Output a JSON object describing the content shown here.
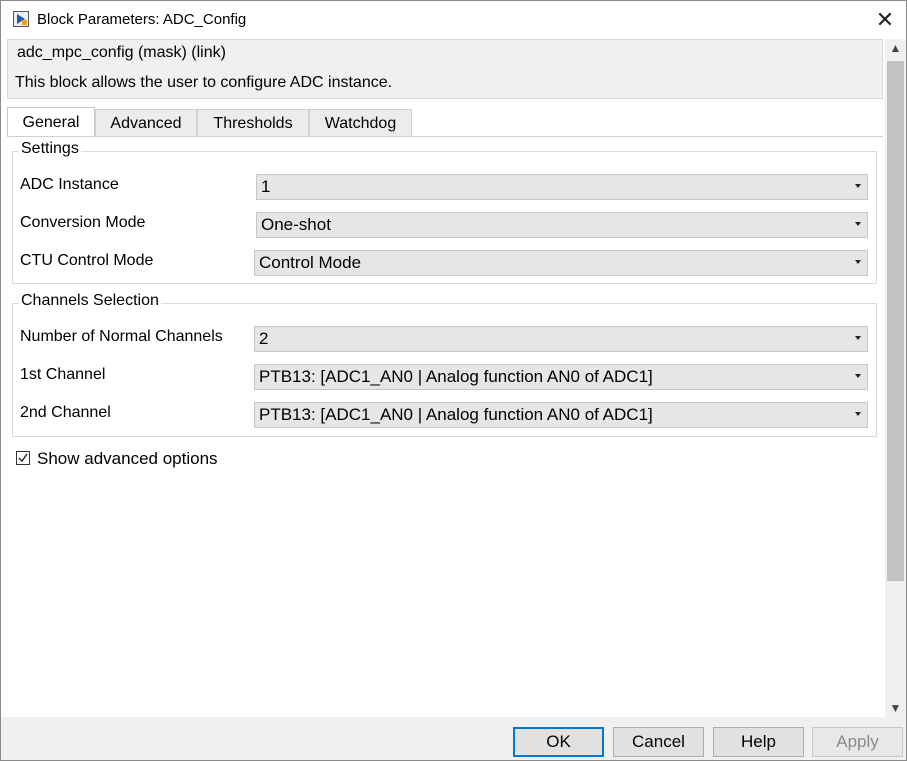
{
  "window": {
    "title": "Block Parameters: ADC_Config",
    "close_glyph": "✕",
    "icon": "simulink-block-icon"
  },
  "mask": {
    "title": "adc_mpc_config (mask) (link)",
    "description": "This block allows the user to configure ADC instance."
  },
  "tabs": [
    {
      "label": "General",
      "active": true
    },
    {
      "label": "Advanced",
      "active": false
    },
    {
      "label": "Thresholds",
      "active": false
    },
    {
      "label": "Watchdog",
      "active": false
    }
  ],
  "settings": {
    "group_title": "Settings",
    "rows": [
      {
        "label": "ADC Instance",
        "value": "1"
      },
      {
        "label": "Conversion Mode",
        "value": "One-shot"
      },
      {
        "label": "CTU Control Mode",
        "value": "Control Mode"
      }
    ]
  },
  "channels": {
    "group_title": "Channels Selection",
    "rows": [
      {
        "label": "Number of Normal Channels",
        "value": "2"
      },
      {
        "label": "1st Channel",
        "value": "PTB13: [ADC1_AN0 | Analog function AN0 of ADC1]"
      },
      {
        "label": "2nd Channel",
        "value": "PTB13: [ADC1_AN0 | Analog function AN0 of ADC1]"
      }
    ]
  },
  "advanced_option": {
    "label": "Show advanced options",
    "checked": true
  },
  "scrollbar": {
    "up": "▲",
    "down": "▼"
  },
  "buttons": {
    "ok": "OK",
    "cancel": "Cancel",
    "help": "Help",
    "apply": "Apply"
  },
  "colors": {
    "focus_accent": "#0078d7",
    "combo_bg": "#e6e6e6",
    "panel_bg": "#f0f0f0"
  }
}
